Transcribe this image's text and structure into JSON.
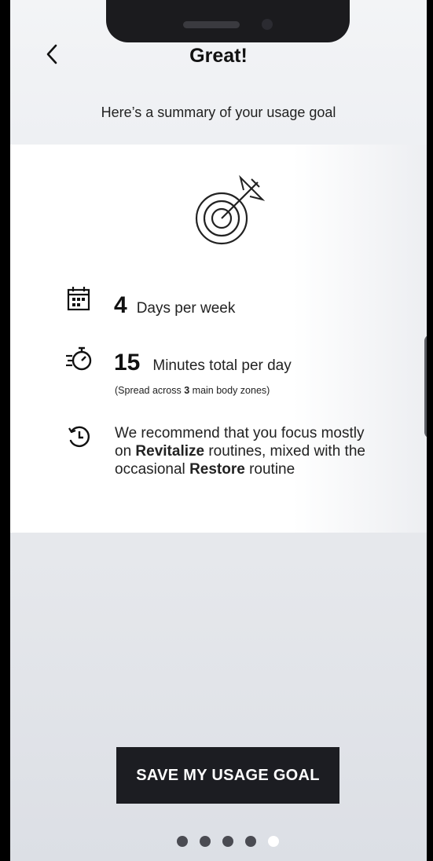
{
  "header": {
    "back_icon": "chevron-left-icon",
    "title": "Great!"
  },
  "subtitle": "Here’s a summary of your usage goal",
  "summary": {
    "goal_icon": "target-arrow-icon",
    "days": {
      "icon": "calendar-icon",
      "value": "4",
      "label": "Days per week"
    },
    "minutes": {
      "icon": "stopwatch-icon",
      "value": "15",
      "label": "Minutes total per day",
      "note_prefix": "(Spread across ",
      "note_count": "3",
      "note_suffix": " main body zones)"
    },
    "recommendation": {
      "icon": "history-clock-icon",
      "text_1": "We recommend that you focus mostly on ",
      "bold_1": "Revitalize",
      "text_2": " routines, mixed with the occasional ",
      "bold_2": "Restore",
      "text_3": " routine"
    }
  },
  "save_button": "SAVE MY USAGE GOAL",
  "pagination": {
    "count": 5,
    "active_index": 4
  },
  "colors": {
    "button_bg": "#1c1d22",
    "text_primary": "#111111",
    "dot_inactive": "#4a4b52",
    "dot_active": "#ffffff"
  }
}
